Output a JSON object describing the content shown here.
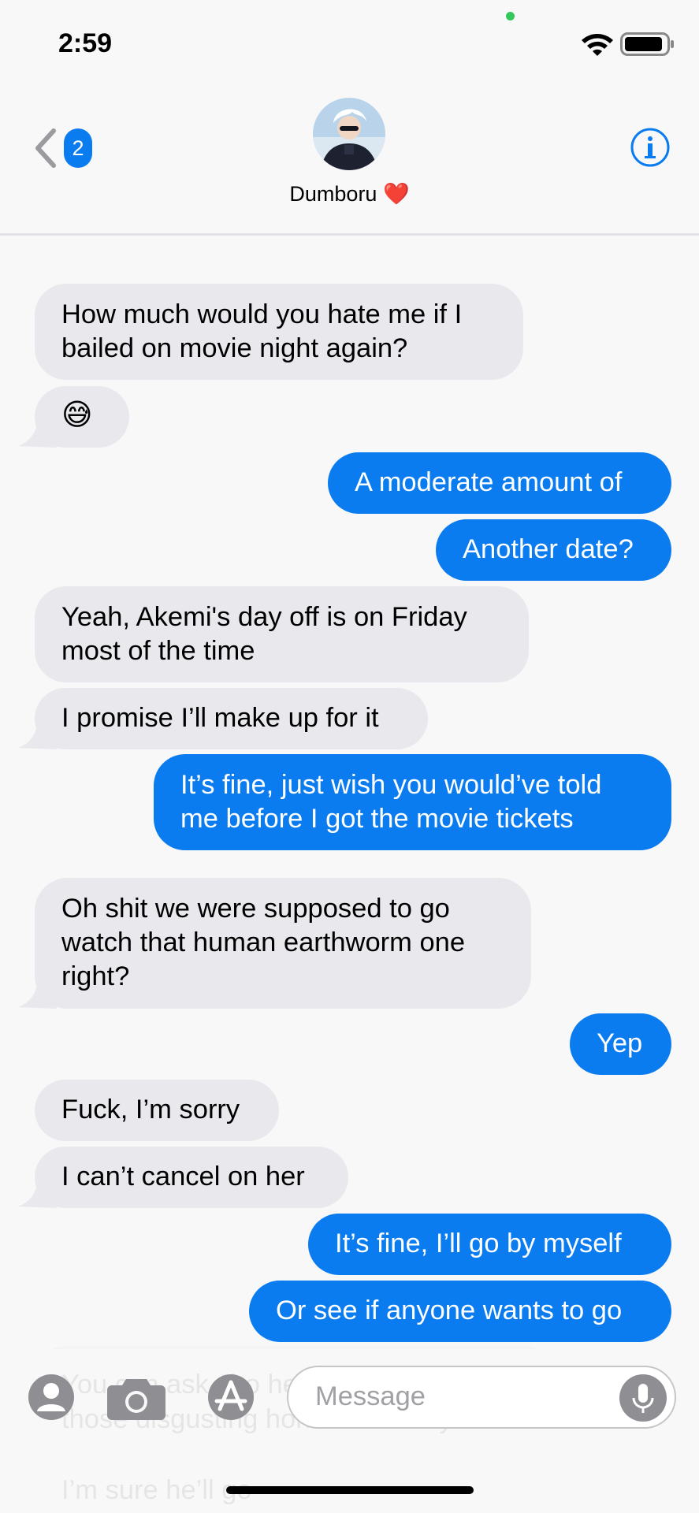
{
  "status_bar": {
    "time": "2:59"
  },
  "header": {
    "back_badge_count": "2",
    "contact_name": "Dumboru ❤️"
  },
  "messages": [
    {
      "from": "them",
      "text": "How much would you hate me if I\nbailed on movie night again?"
    },
    {
      "from": "them",
      "text": "😅"
    },
    {
      "from": "me",
      "text": "A moderate amount of"
    },
    {
      "from": "me",
      "text": "Another date?"
    },
    {
      "from": "them",
      "text": "Yeah, Akemi's day off is on Friday\nmost of the time"
    },
    {
      "from": "them",
      "text": "I promise I’ll make up for it"
    },
    {
      "from": "me",
      "text": "It’s fine, just wish you would’ve told\nme before I got the movie tickets"
    },
    {
      "from": "them",
      "text": "Oh shit we were supposed to go\nwatch that human earthworm one\nright?"
    },
    {
      "from": "me",
      "text": "Yep"
    },
    {
      "from": "them",
      "text": "Fuck, I’m sorry"
    },
    {
      "from": "them",
      "text": "I can’t cancel on her"
    },
    {
      "from": "me",
      "text": "It’s fine, I’ll go by myself"
    },
    {
      "from": "me",
      "text": "Or see if anyone wants to go"
    }
  ],
  "input_bar": {
    "placeholder": "Message",
    "obscured_text": [
      "You can ask Jiro he likes all",
      "those disgusting horror movies you do",
      "I’m sure he’ll go"
    ]
  },
  "colors": {
    "outgoing_bubble": "#0a7cf0",
    "incoming_bubble": "#e9e8ed",
    "accent": "#0a7cf0"
  },
  "icons": [
    "wifi-icon",
    "battery-icon",
    "back-chevron-icon",
    "info-icon",
    "contacts-icon",
    "camera-icon",
    "appstore-icon",
    "microphone-icon"
  ]
}
